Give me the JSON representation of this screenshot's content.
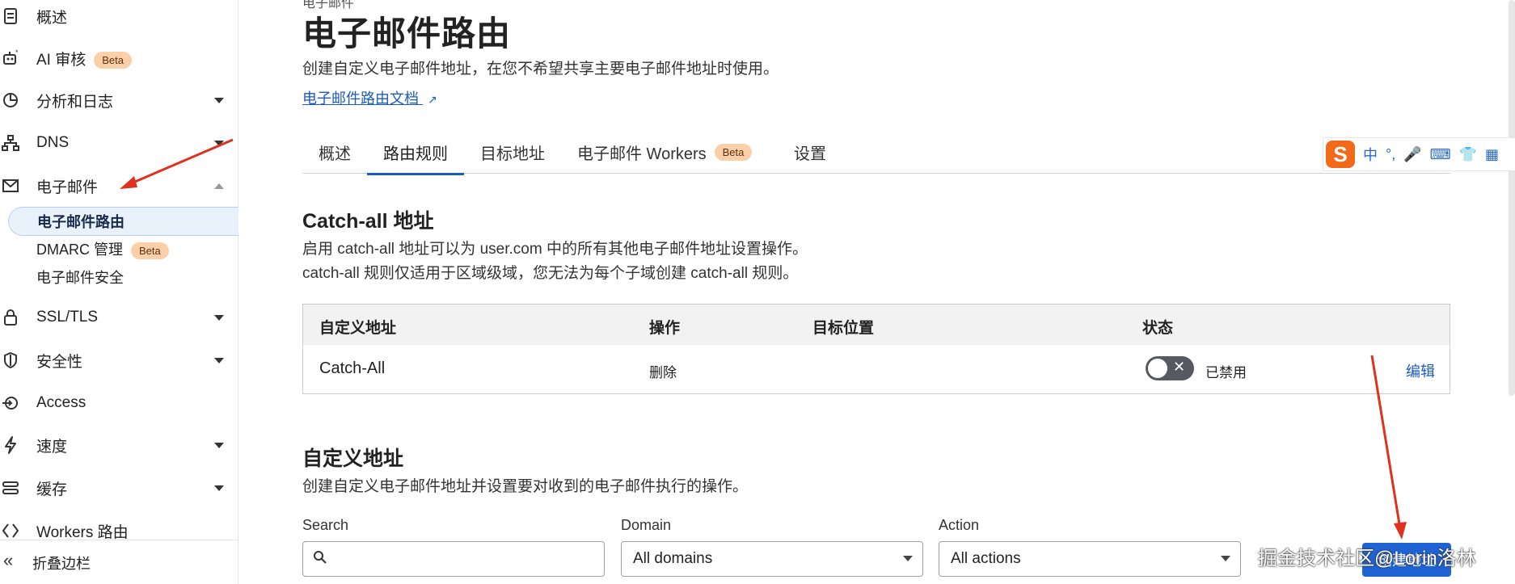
{
  "sidebar": {
    "items": [
      {
        "label": "概述",
        "icon": "document-icon",
        "caret": ""
      },
      {
        "label": "AI 审核",
        "icon": "robot-icon",
        "badge": "Beta",
        "caret": ""
      },
      {
        "label": "分析和日志",
        "icon": "pie-chart-icon",
        "caret": "down"
      },
      {
        "label": "DNS",
        "icon": "network-icon",
        "caret": "down"
      },
      {
        "label": "电子邮件",
        "icon": "mail-icon",
        "caret": "up"
      },
      {
        "label": "SSL/TLS",
        "icon": "lock-icon",
        "caret": "down"
      },
      {
        "label": "安全性",
        "icon": "shield-icon",
        "caret": "down"
      },
      {
        "label": "Access",
        "icon": "access-icon",
        "caret": ""
      },
      {
        "label": "速度",
        "icon": "lightning-icon",
        "caret": "down"
      },
      {
        "label": "缓存",
        "icon": "stack-icon",
        "caret": "down"
      },
      {
        "label": "Workers 路由",
        "icon": "workers-icon",
        "caret": ""
      }
    ],
    "email_sub": [
      {
        "label": "电子邮件路由",
        "active": true
      },
      {
        "label": "DMARC 管理",
        "badge": "Beta"
      },
      {
        "label": "电子邮件安全"
      }
    ],
    "collapse_label": "折叠边栏"
  },
  "page": {
    "crumb": "电子邮件",
    "title": "电子邮件路由",
    "subtitle": "创建自定义电子邮件地址，在您不希望共享主要电子邮件地址时使用。",
    "doc_link": "电子邮件路由文档"
  },
  "tabs": [
    {
      "label": "概述"
    },
    {
      "label": "路由规则",
      "active": true
    },
    {
      "label": "目标地址"
    },
    {
      "label": "电子邮件 Workers",
      "badge": "Beta"
    },
    {
      "label": "设置"
    }
  ],
  "catch_all": {
    "title": "Catch-all 地址",
    "desc1": "启用 catch-all 地址可以为 user.com 中的所有其他电子邮件地址设置操作。",
    "desc2": "catch-all 规则仅适用于区域级域，您无法为每个子域创建 catch-all 规则。",
    "headers": [
      "自定义地址",
      "操作",
      "目标位置",
      "状态"
    ],
    "row": {
      "address": "Catch-All",
      "action": "删除",
      "destination": "",
      "status": "已禁用",
      "edit": "编辑",
      "enabled": false
    }
  },
  "custom": {
    "title": "自定义地址",
    "desc": "创建自定义电子邮件地址并设置要对收到的电子邮件执行的操作。",
    "search_label": "Search",
    "search_value": "",
    "domain_label": "Domain",
    "domain_value": "All domains",
    "action_label": "Action",
    "action_value": "All actions",
    "create_button": "创建地址"
  },
  "ime": {
    "labels": [
      "S",
      "中",
      "°,",
      "🎤",
      "⌨",
      "👕",
      "▦"
    ]
  },
  "watermark": "掘金技术社区@Lorin洛林",
  "colors": {
    "accent": "#1b5bbf",
    "beta_bg": "#fbd0a8",
    "annotation_arrow": "#e0301e"
  }
}
